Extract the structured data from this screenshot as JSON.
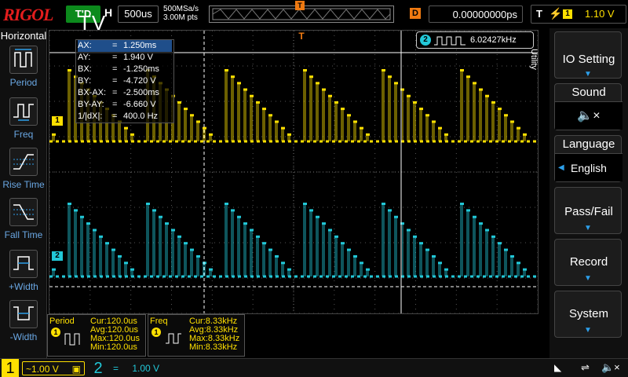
{
  "brand": "RIGOL",
  "run_state": "T'D",
  "overlay_text": "TV",
  "horizontal": {
    "label": "H",
    "timebase": "500us",
    "sample_rate": "500MSa/s",
    "memory_depth": "3.00M pts"
  },
  "trigger": {
    "marker": "T",
    "delay_label": "D",
    "delay_value": "0.00000000ps",
    "type_label": "T",
    "source": "1",
    "level": "1.10 V"
  },
  "left_menu": {
    "title": "Horizontal",
    "items": [
      {
        "label": "Period",
        "icon": "period-icon"
      },
      {
        "label": "Freq",
        "icon": "freq-icon"
      },
      {
        "label": "Rise Time",
        "icon": "rise-time-icon"
      },
      {
        "label": "Fall Time",
        "icon": "fall-time-icon"
      },
      {
        "label": "+Width",
        "icon": "plus-width-icon"
      },
      {
        "label": "-Width",
        "icon": "minus-width-icon"
      }
    ]
  },
  "right_menu": {
    "side_label": "Utility",
    "items": [
      {
        "label": "IO Setting",
        "value": ""
      },
      {
        "label": "Sound",
        "value": ""
      },
      {
        "label": "Language",
        "value": "English"
      },
      {
        "label": "Pass/Fail",
        "value": ""
      },
      {
        "label": "Record",
        "value": ""
      },
      {
        "label": "System",
        "value": ""
      }
    ]
  },
  "cursor_table": [
    {
      "name": "AX:",
      "value": "1.250ms"
    },
    {
      "name": "AY:",
      "value": "1.940 V"
    },
    {
      "name": "BX:",
      "value": "-1.250ms"
    },
    {
      "name": "BY:",
      "value": "-4.720 V"
    },
    {
      "name": "BX-AX:",
      "value": "-2.500ms"
    },
    {
      "name": "BY-AY:",
      "value": "-6.660 V"
    },
    {
      "name": "1/|dX|:",
      "value": "400.0 Hz"
    }
  ],
  "freq_counter": {
    "channel": "2",
    "value": "6.02427kHz"
  },
  "channel_markers": {
    "ch1": "1",
    "ch2": "2"
  },
  "measurements": [
    {
      "title": "Period",
      "channel": "1",
      "cur": "Cur:120.0us",
      "avg": "Avg:120.0us",
      "max": "Max:120.0us",
      "min": "Min:120.0us"
    },
    {
      "title": "Freq",
      "channel": "1",
      "cur": "Cur:8.33kHz",
      "avg": "Avg:8.33kHz",
      "max": "Max:8.33kHz",
      "min": "Min:8.33kHz"
    }
  ],
  "channels": [
    {
      "num": "1",
      "coupling": "~",
      "scale": "1.00 V",
      "color": "#ffe000"
    },
    {
      "num": "2",
      "coupling": "=",
      "scale": "1.00 V",
      "color": "#22c8d8"
    }
  ],
  "colors": {
    "ch1": "#ffe000",
    "ch2": "#22c8d8",
    "accent": "#2d9fea",
    "trigger": "#f07a11",
    "run": "#0c8a1c"
  }
}
